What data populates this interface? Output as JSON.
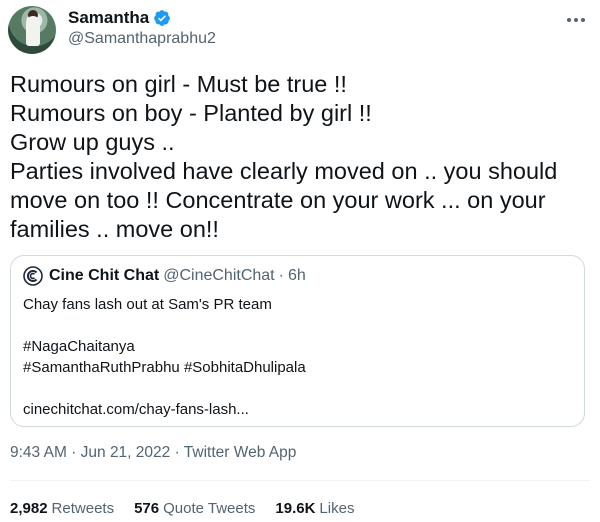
{
  "tweet": {
    "author": {
      "name": "Samantha",
      "handle": "@Samanthaprabhu2",
      "verified": true
    },
    "text_lines": [
      "Rumours on girl - Must be true !!",
      "Rumours on boy - Planted by girl !!",
      "Grow up guys ..",
      "Parties involved have clearly moved on .. you should",
      "move on too !! Concentrate on your work ... on your",
      "families .. move on!!"
    ],
    "quoted": {
      "name": "Cine Chit Chat",
      "handle": "@CineChitChat",
      "separator": "·",
      "time": "6h",
      "lines": [
        "Chay fans lash out at Sam's PR team",
        "",
        "#NagaChaitanya",
        "#SamanthaRuthPrabhu #SobhitaDhulipala",
        "",
        "cinechitchat.com/chay-fans-lash..."
      ]
    },
    "meta": "9:43 AM · Jun 21, 2022 · Twitter Web App",
    "stats": [
      {
        "value": "2,982",
        "label": "Retweets"
      },
      {
        "value": "576",
        "label": "Quote Tweets"
      },
      {
        "value": "19.6K",
        "label": "Likes"
      }
    ]
  },
  "colors": {
    "text": "#0f1419",
    "secondary": "#536471",
    "verified_blue": "#1d9bf0",
    "border": "#cfd9de"
  }
}
